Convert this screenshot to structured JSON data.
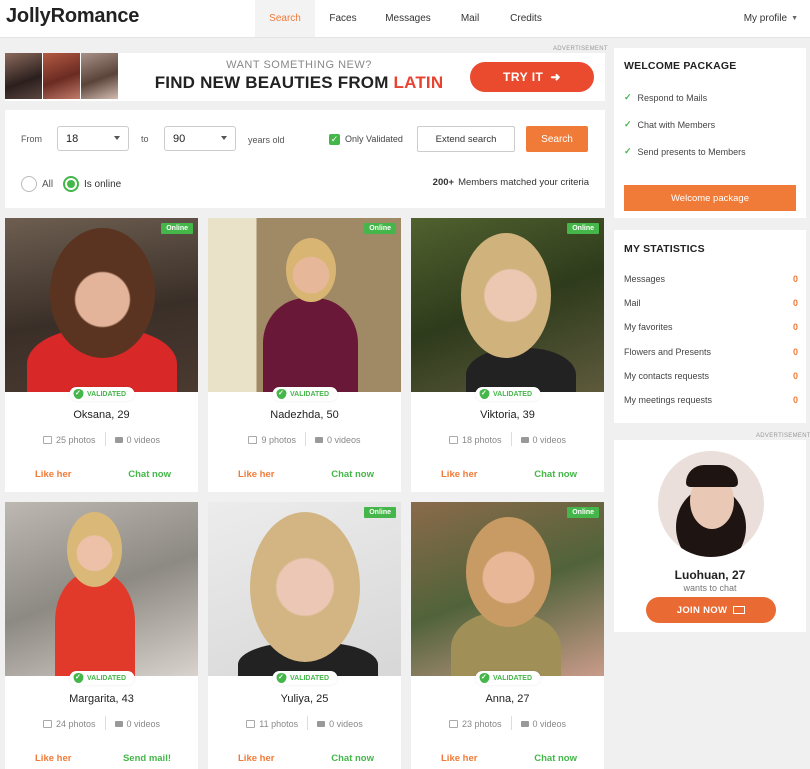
{
  "header": {
    "logo": "JollyRomance",
    "nav": [
      {
        "label": "Search",
        "active": true
      },
      {
        "label": "Faces",
        "active": false
      },
      {
        "label": "Messages",
        "active": false
      },
      {
        "label": "Mail",
        "active": false
      },
      {
        "label": "Credits",
        "active": false
      }
    ],
    "profile_label": "My profile"
  },
  "ads": {
    "label": "ADVERTISEMENT"
  },
  "banner": {
    "subtitle": "WANT SOMETHING NEW?",
    "headline": "FIND NEW BEAUTIES FROM ",
    "headline_highlight": "LATIN",
    "cta": "TRY IT"
  },
  "search": {
    "from_label": "From",
    "from_value": "18",
    "to_label": "to",
    "to_value": "90",
    "age_suffix": "years old",
    "only_validated_label": "Only Validated",
    "only_validated_checked": true,
    "extend_label": "Extend search",
    "search_label": "Search",
    "filter_all": "All",
    "filter_online": "Is online",
    "filter_selected": "Is online",
    "match_count": "200+",
    "match_text": "Members matched your criteria"
  },
  "badges": {
    "online": "Online",
    "validated": "VALIDATED"
  },
  "profiles": [
    {
      "name": "Oksana, 29",
      "photos": "25 photos",
      "videos": "0 videos",
      "like": "Like her",
      "action": "Chat now",
      "online": true
    },
    {
      "name": "Nadezhda, 50",
      "photos": "9 photos",
      "videos": "0 videos",
      "like": "Like her",
      "action": "Chat now",
      "online": true
    },
    {
      "name": "Viktoria, 39",
      "photos": "18 photos",
      "videos": "0 videos",
      "like": "Like her",
      "action": "Chat now",
      "online": true
    },
    {
      "name": "Margarita, 43",
      "photos": "24 photos",
      "videos": "0 videos",
      "like": "Like her",
      "action": "Send mail!",
      "online": false
    },
    {
      "name": "Yuliya, 25",
      "photos": "11 photos",
      "videos": "0 videos",
      "like": "Like her",
      "action": "Chat now",
      "online": true
    },
    {
      "name": "Anna, 27",
      "photos": "23 photos",
      "videos": "0 videos",
      "like": "Like her",
      "action": "Chat now",
      "online": true
    }
  ],
  "welcome": {
    "title": "WELCOME PACKAGE",
    "items": [
      "Respond to Mails",
      "Chat with Members",
      "Send presents to Members"
    ],
    "button": "Welcome package"
  },
  "stats": {
    "title": "MY STATISTICS",
    "rows": [
      {
        "label": "Messages",
        "value": "0"
      },
      {
        "label": "Mail",
        "value": "0"
      },
      {
        "label": "My favorites",
        "value": "0"
      },
      {
        "label": "Flowers and Presents",
        "value": "0"
      },
      {
        "label": "My contacts requests",
        "value": "0"
      },
      {
        "label": "My meetings requests",
        "value": "0"
      }
    ]
  },
  "promo": {
    "name": "Luohuan, 27",
    "subtitle": "wants to chat",
    "button": "JOIN NOW"
  },
  "colors": {
    "accent": "#f07b38",
    "green": "#45b649",
    "red": "#ea4b2e"
  },
  "icons": {
    "check": "check-icon",
    "photo": "photo-icon",
    "video": "video-icon",
    "mail": "mail-icon",
    "arrow": "arrow-right-icon"
  }
}
